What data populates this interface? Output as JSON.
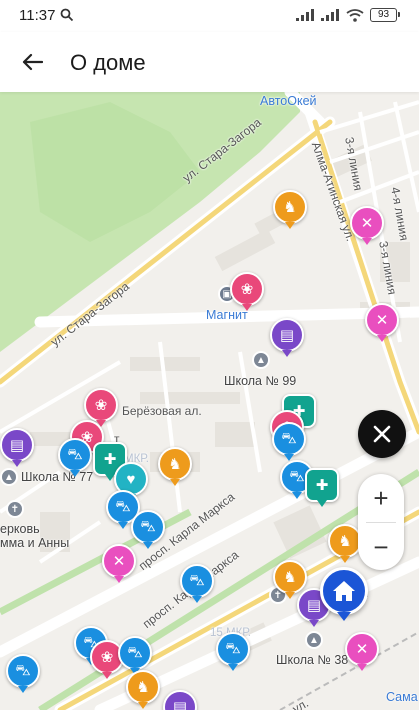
{
  "status": {
    "time": "11:37",
    "battery": "93"
  },
  "header": {
    "title": "О доме"
  },
  "map": {
    "labels": {
      "avtookey": "АвтоОкей",
      "street_stara_zagora_1": "ул. Стара-Загора",
      "street_stara_zagora_2": "ул. Стара-Загора",
      "street_alma_atinskaya": "Алма-Атинская ул.",
      "line_3_a": "3-я линия",
      "line_3_b": "3-я линия",
      "line_4": "4-я линия",
      "magnit": "Магнит",
      "school_99": "Школа № 99",
      "berezovaya": "Берёзовая ал.",
      "school_77": "Школа № 77",
      "church_1": "ерковь",
      "church_2": "мма и Анны",
      "mkr_left": "МКР.",
      "karla_marksa_1": "просп. Карла Маркса",
      "karla_marksa_2": "просп. Карла Маркса",
      "mkr_15": "15 МКР.",
      "school_38": "Школа № 38",
      "street_bottom": "ул.",
      "samara": "Сама",
      "edge_a": "а",
      "edge_t": "т",
      "edge_ya": "я"
    }
  },
  "colors": {
    "shop": "#1a8fe0",
    "food": "#e94fbf",
    "beauty": "#e9487a",
    "kids": "#ee9b1c",
    "pharmacy": "#11a38f",
    "books": "#7a48c8",
    "house": "#1b55d6"
  },
  "controls": {
    "zoom_in": "+",
    "zoom_out": "−",
    "close": "×"
  }
}
